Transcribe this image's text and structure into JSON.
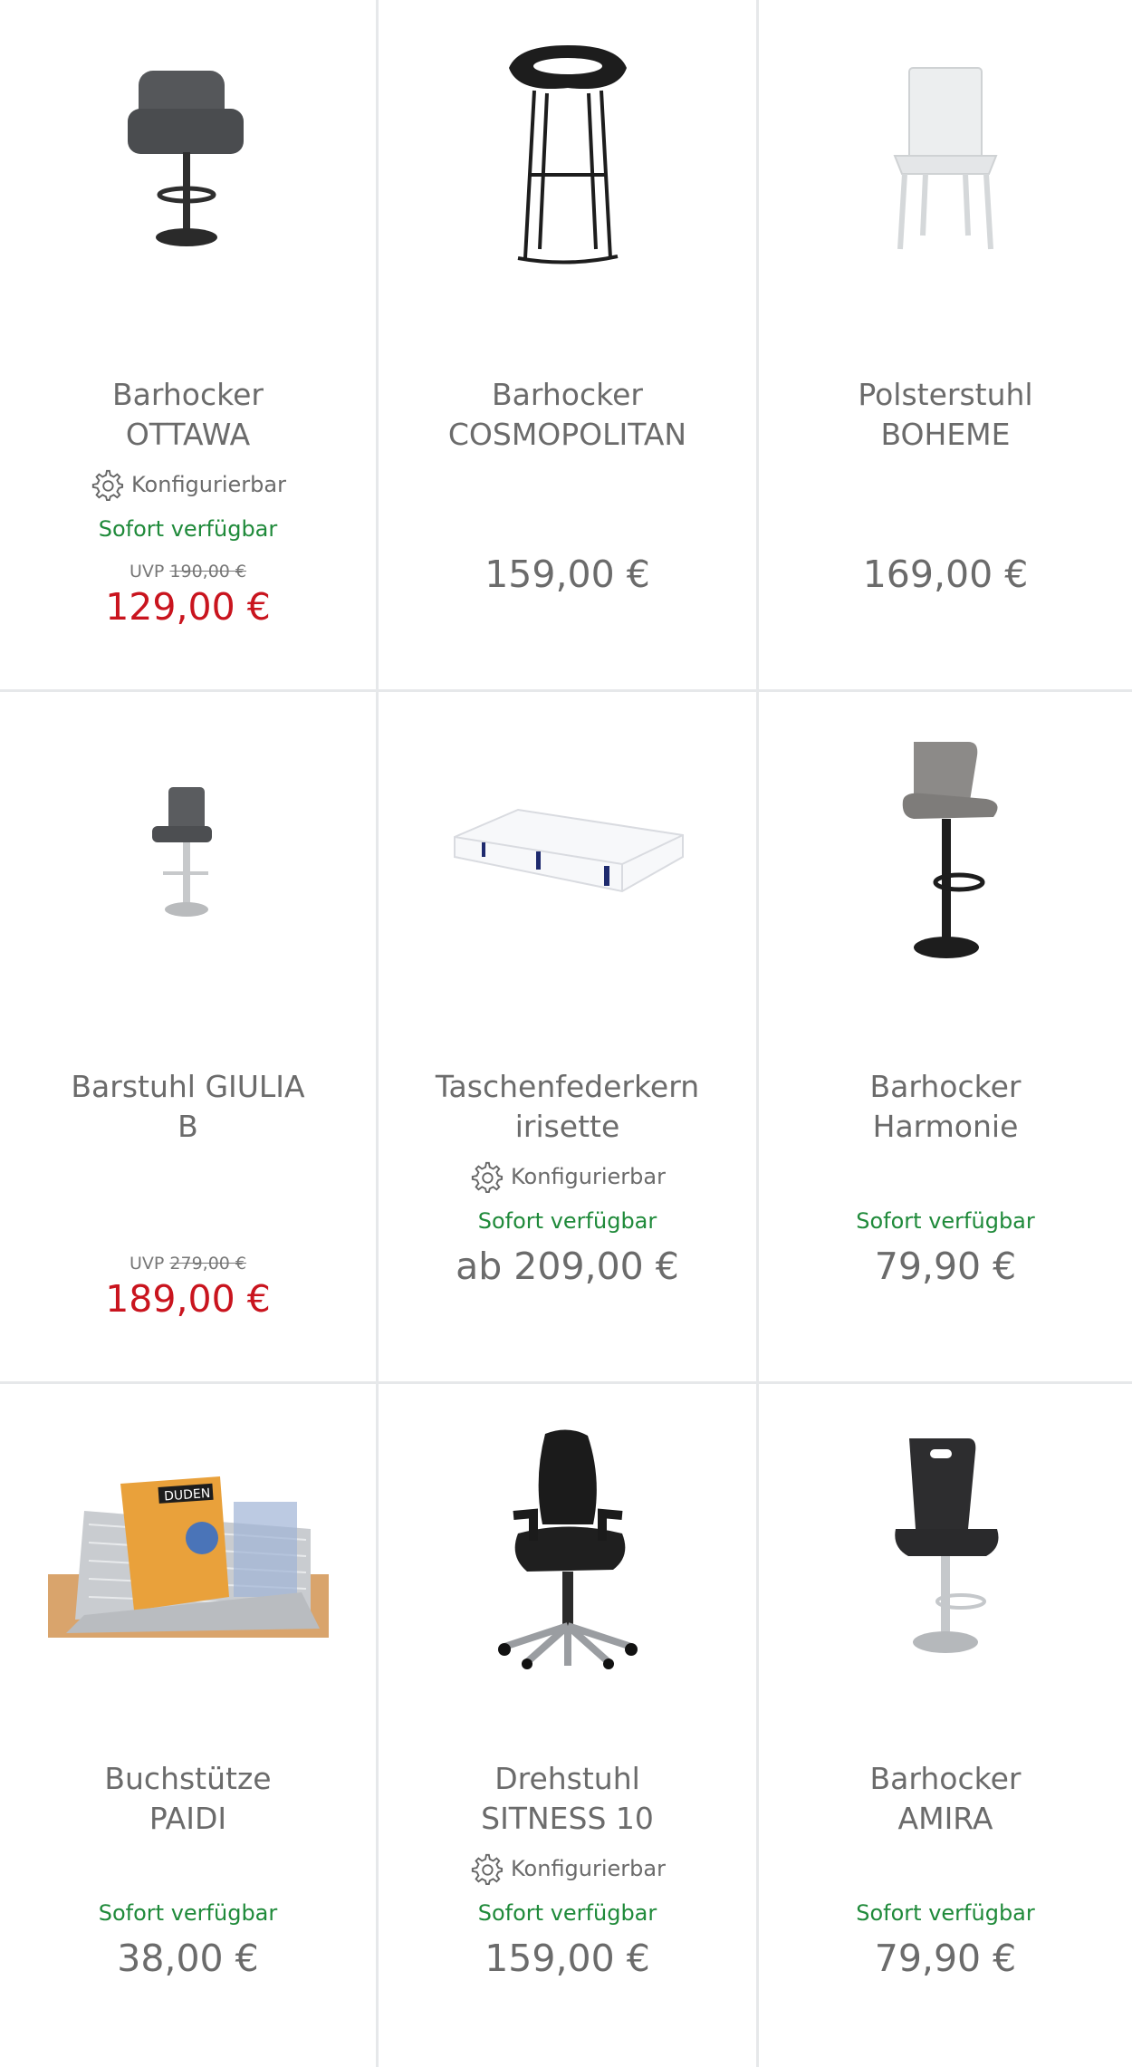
{
  "products": [
    {
      "name": "Barhocker\nOTTAWA",
      "configurable": "Konfigurierbar",
      "availability": "Sofort verfügbar",
      "uvp_label": "UVP",
      "uvp_price": "190,00 €",
      "price": "129,00 €",
      "image": "bar-stool-ottawa"
    },
    {
      "name": "Barhocker\nCOSMOPOLITAN",
      "price": "159,00 €",
      "image": "bar-stool-cosmopolitan"
    },
    {
      "name": "Polsterstuhl\nBOHEME",
      "price": "169,00 €",
      "image": "chair-boheme"
    },
    {
      "name": "Barstuhl GIULIA\nB",
      "uvp_label": "UVP",
      "uvp_price": "279,00 €",
      "price": "189,00 €",
      "image": "bar-stool-giulia"
    },
    {
      "name": "Taschenfederkern\nirisette",
      "configurable": "Konfigurierbar",
      "availability": "Sofort verfügbar",
      "price": "ab 209,00 €",
      "image": "mattress-irisette"
    },
    {
      "name": "Barhocker\nHarmonie",
      "availability": "Sofort verfügbar",
      "price": "79,90 €",
      "image": "bar-stool-harmonie"
    },
    {
      "name": "Buchstütze\nPAIDI",
      "availability": "Sofort verfügbar",
      "price": "38,00 €",
      "image": "book-stand-paidi"
    },
    {
      "name": "Drehstuhl\nSITNESS 10",
      "configurable": "Konfigurierbar",
      "availability": "Sofort verfügbar",
      "price": "159,00 €",
      "image": "office-chair-sitness"
    },
    {
      "name": "Barhocker\nAMIRA",
      "availability": "Sofort verfügbar",
      "price": "79,90 €",
      "image": "bar-stool-amira"
    }
  ],
  "book_cover_text": "DUDEN",
  "colors": {
    "available": "#1f8a3a",
    "sale_price": "#c9141e",
    "text": "#6b6b6b",
    "border": "#e6e8ea"
  }
}
